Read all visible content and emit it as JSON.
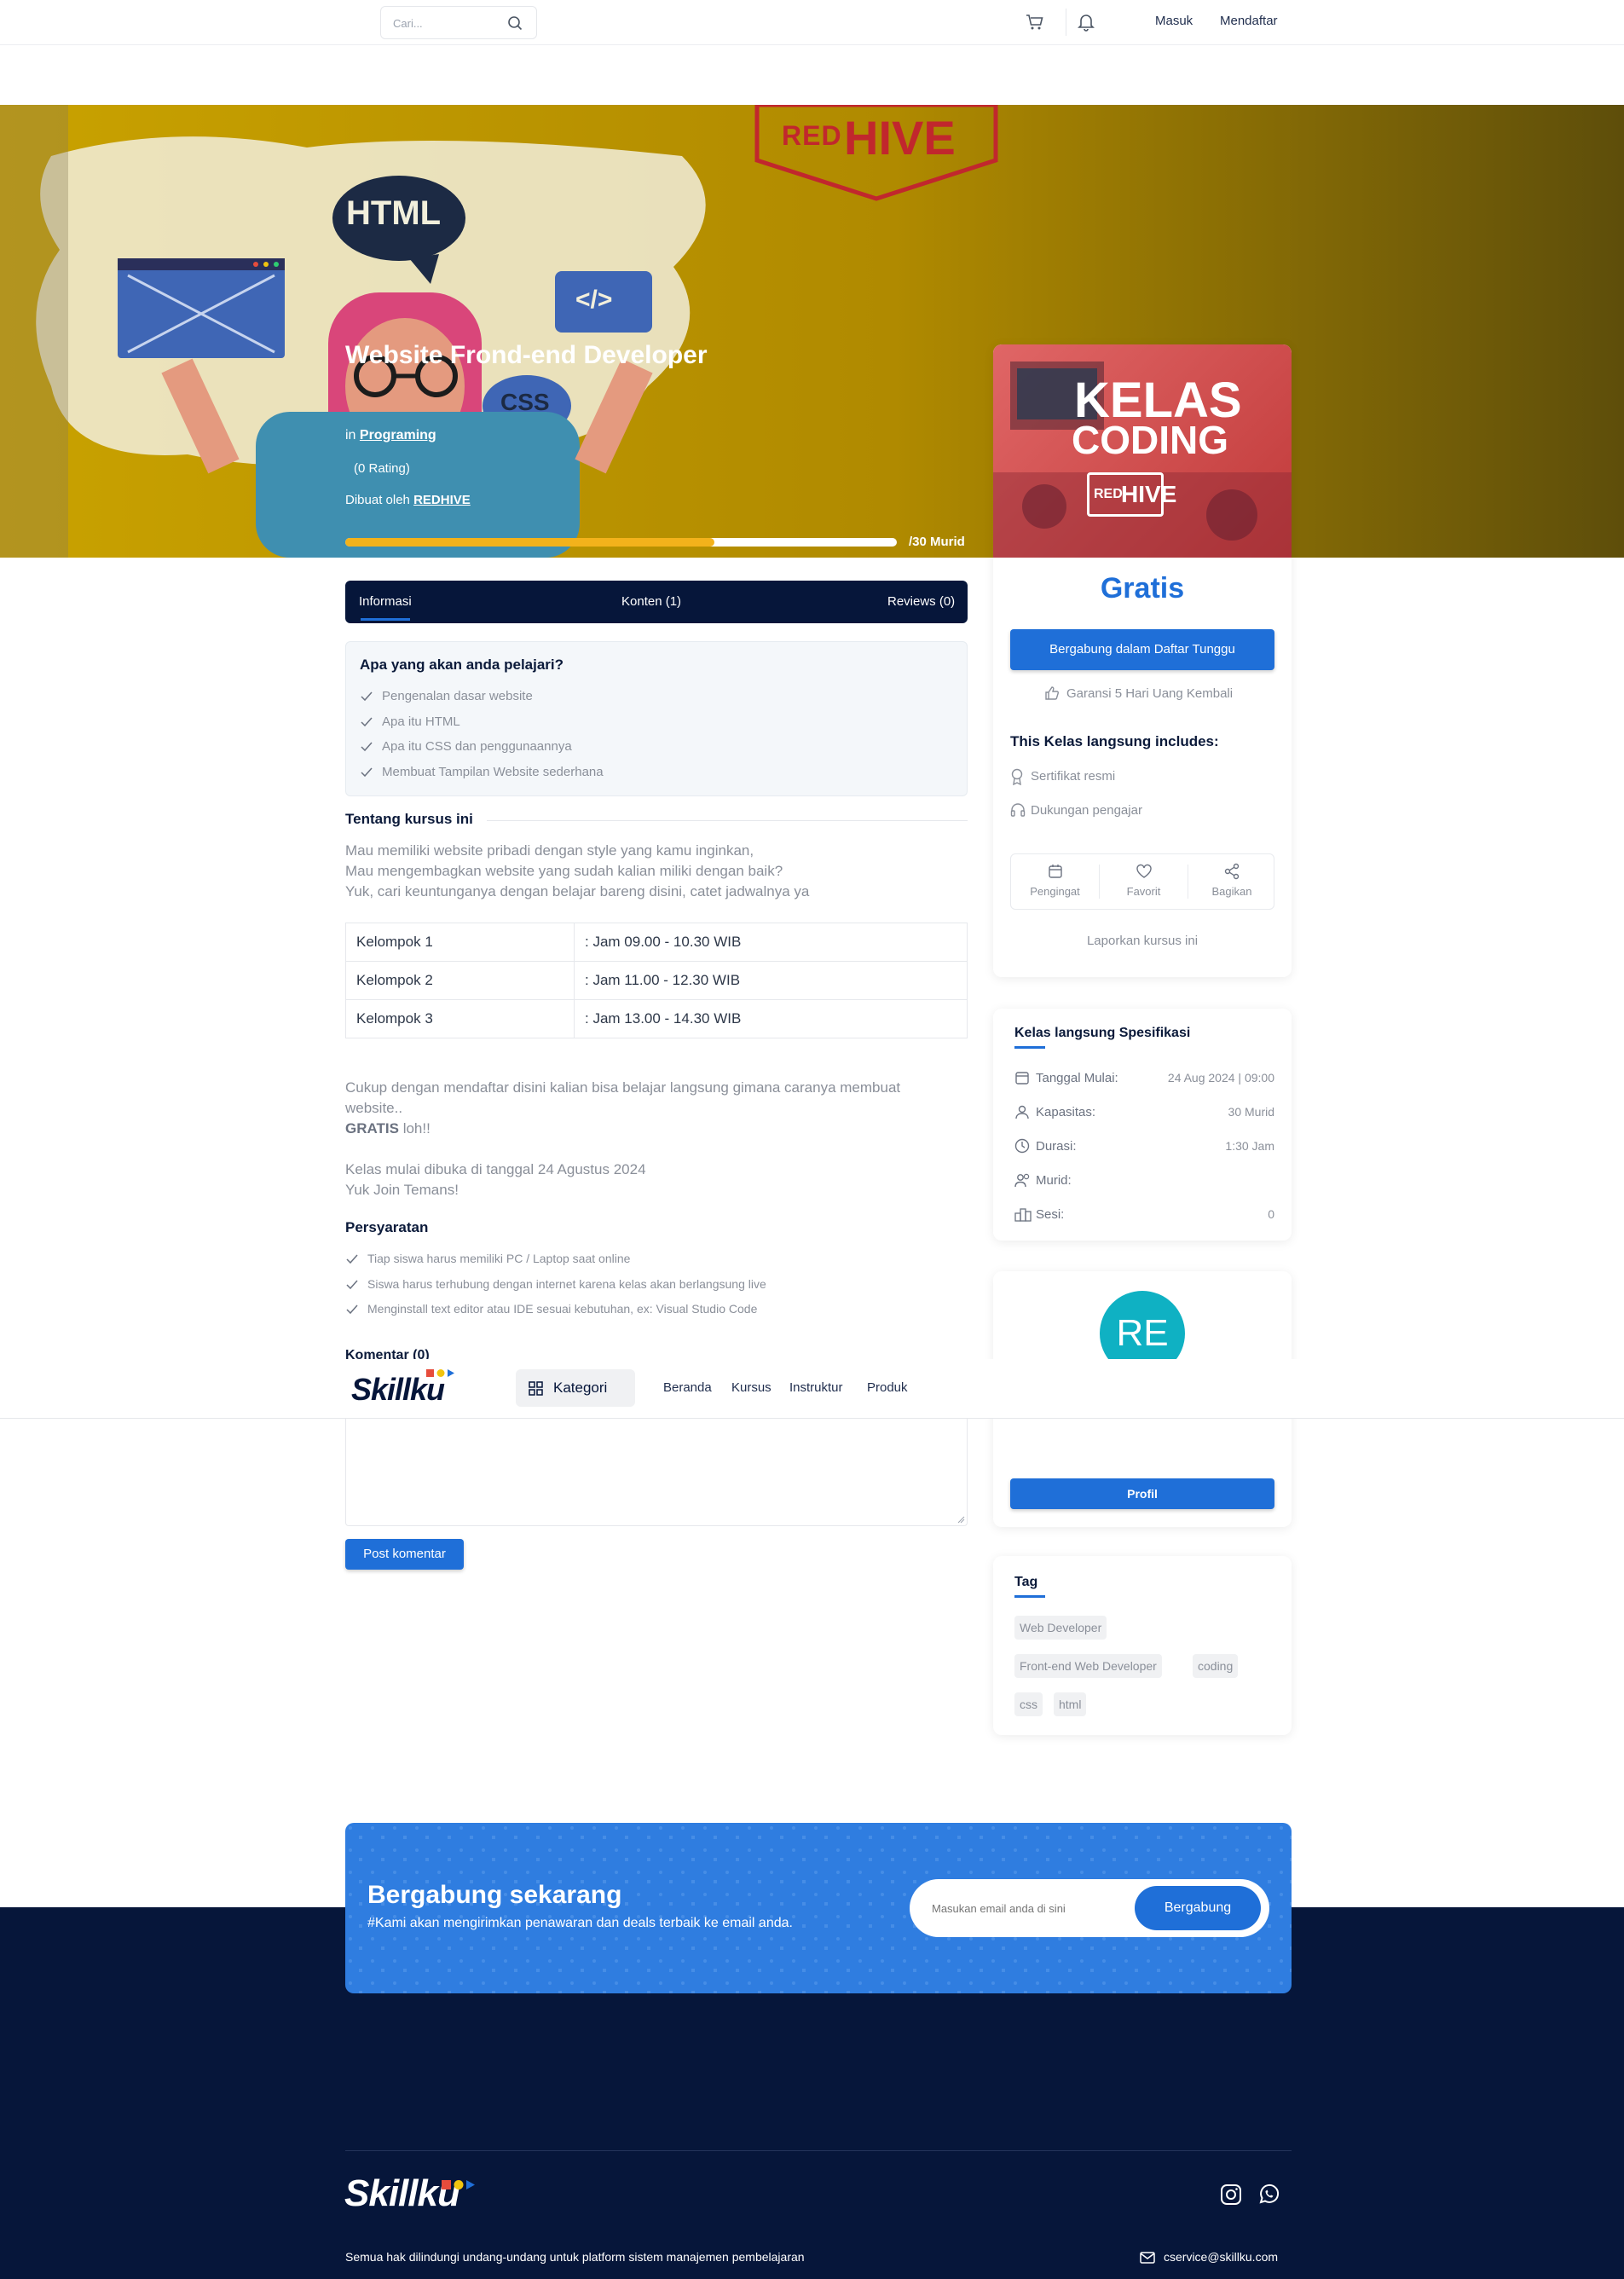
{
  "header": {
    "search_placeholder": "Cari...",
    "login": "Masuk",
    "register": "Mendaftar"
  },
  "hero": {
    "title": "Website Frond-end Developer",
    "in_label": "in",
    "category": "Programing",
    "rating": "(0 Rating)",
    "created_by_label": "Dibuat oleh",
    "creator": "REDHIVE",
    "capacity_label": "/30 Murid",
    "progress_percent": 67,
    "banner_logo_red": "RED",
    "banner_logo_hive": "HIVE",
    "bubble_html": "HTML",
    "bubble_css": "CSS",
    "bubble_code": "</>"
  },
  "tabs": [
    "Informasi",
    "Konten (1)",
    "Reviews (0)"
  ],
  "learn": {
    "title": "Apa yang akan anda pelajari?",
    "items": [
      "Pengenalan dasar website",
      "Apa itu HTML",
      "Apa itu CSS dan penggunaannya",
      "Membuat Tampilan Website sederhana"
    ]
  },
  "about": {
    "title": "Tentang kursus ini",
    "lines": [
      "Mau memiliki website pribadi dengan style yang kamu inginkan,",
      "Mau mengembagkan website yang sudah kalian miliki dengan baik?",
      "Yuk, cari keuntunganya dengan belajar bareng disini, catet jadwalnya ya"
    ],
    "schedule": [
      {
        "group": "Kelompok 1",
        "time": ": Jam 09.00 - 10.30 WIB"
      },
      {
        "group": "Kelompok 2",
        "time": ": Jam 11.00 - 12.30 WIB"
      },
      {
        "group": "Kelompok 3",
        "time": ": Jam 13.00 - 14.30 WIB"
      }
    ],
    "after1": "Cukup dengan mendaftar disini kalian bisa belajar langsung gimana caranya membuat",
    "after2": "website..",
    "gratis_bold": "GRATIS",
    "gratis_rest": " loh!!",
    "after3": "Kelas mulai dibuka di tanggal 24 Agustus 2024",
    "after4": "Yuk Join Temans!"
  },
  "requirements": {
    "title": "Persyaratan",
    "items": [
      "Tiap siswa harus memiliki PC / Laptop saat online",
      "Siswa harus terhubung dengan internet karena kelas akan berlangsung live",
      "Menginstall text editor atau IDE sesuai kebutuhan, ex: Visual Studio Code"
    ]
  },
  "comments": {
    "title": "Komentar (0)",
    "submit": "Post komentar"
  },
  "sidebar": {
    "thumb_line1": "KELAS",
    "thumb_line2": "CODING",
    "thumb_logo_red": "RED",
    "thumb_logo_hive": "HIVE",
    "price": "Gratis",
    "waitlist_button": "Bergabung dalam Daftar Tunggu",
    "guarantee": "Garansi 5 Hari Uang Kembali",
    "includes_title": "This Kelas langsung includes:",
    "includes": [
      "Sertifikat resmi",
      "Dukungan pengajar"
    ],
    "actions": [
      "Pengingat",
      "Favorit",
      "Bagikan"
    ],
    "report": "Laporkan kursus ini"
  },
  "spec": {
    "title": "Kelas langsung Spesifikasi",
    "rows": [
      {
        "label": "Tanggal Mulai:",
        "value": "24 Aug 2024 | 09:00"
      },
      {
        "label": "Kapasitas:",
        "value": "30 Murid"
      },
      {
        "label": "Durasi:",
        "value": "1:30 Jam"
      },
      {
        "label": "Murid:",
        "value": ""
      },
      {
        "label": "Sesi:",
        "value": "0"
      }
    ]
  },
  "instructor": {
    "initials": "RE",
    "profile_button": "Profil"
  },
  "tags": {
    "title": "Tag",
    "items": [
      "Web Developer",
      "Front-end Web Developer",
      "coding",
      "css",
      "html"
    ]
  },
  "navbar": {
    "logo": "Skillku",
    "category_button": "Kategori",
    "links": [
      "Beranda",
      "Kursus",
      "Instruktur",
      "Produk"
    ]
  },
  "newsletter": {
    "title": "Bergabung sekarang",
    "subtitle": "#Kami akan mengirimkan penawaran dan deals terbaik ke email anda.",
    "placeholder": "Masukan email anda di sini",
    "button": "Bergabung"
  },
  "footer": {
    "logo": "Skillku",
    "copyright": "Semua hak dilindungi undang-undang untuk platform sistem manajemen pembelajaran",
    "email": "cservice@skillku.com"
  },
  "colors": {
    "navy": "#06163a",
    "blue": "#1f6fd8",
    "progress": "#f3b21b",
    "teal": "#0fb1c3"
  }
}
